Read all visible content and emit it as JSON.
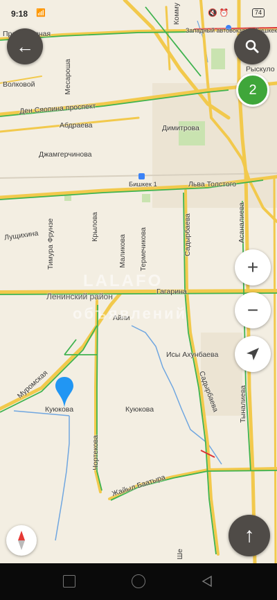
{
  "status_bar": {
    "time": "9:18",
    "signal": "📶",
    "icons": "🔇 ⏰",
    "battery": "74"
  },
  "streets": {
    "profsoyuznaya": "Профсоюзная",
    "volkovoi": "Волковой",
    "mesarosha": "Месароша",
    "den_syaopina": "Ден Сяопина проспект",
    "abdraeva": "Абдраева",
    "dzhamgerchinova": "Джамгерчинова",
    "dimitrova": "Димитрова",
    "kommuna": "Комму",
    "zapadny_avtovokzal": "Западный автовокзал г. Бишкек",
    "ryskulo": "Рыскуло",
    "bishkek1": "Бишкек 1",
    "lva_tolstogo": "Льва Толстого",
    "lushchikhina": "Лущихина",
    "timura_frunze": "Тимура Фрунзе",
    "krylova": "Крылова",
    "malikova": "Маликова",
    "termechikova": "Термечикова",
    "sadyrbaeva1": "Садырбаева",
    "asanalieva": "Асаналиева",
    "gagarina": "Гагарина",
    "leninsky": "Ленинский район",
    "aini": "Айни",
    "isy_akhunbaeva": "Исы Ахунбаева",
    "muromskaya": "Муромская",
    "kuyukova1": "Куюкова",
    "kuyukova2": "Куюкова",
    "sadyrbaeva2": "Садырбаева",
    "tynalieva": "Тыналиева",
    "chortekova": "Чортекова",
    "zhaiyl_baatyra": "Жайыл Баатыра",
    "she": "Ше"
  },
  "watermark": {
    "line1": "LALAFO",
    "line2": "объявлений"
  },
  "controls": {
    "back_icon": "←",
    "search_icon": "⚲",
    "results_count": "2",
    "zoom_in": "+",
    "zoom_out": "−",
    "locate_icon": "➤",
    "route_icon": "↑"
  },
  "colors": {
    "road_yellow": "#f2c94c",
    "traffic_green": "#3fb34f",
    "river_blue": "#6fa6e0",
    "pin_blue": "#2196f3",
    "park_green": "#c9e3b0"
  }
}
